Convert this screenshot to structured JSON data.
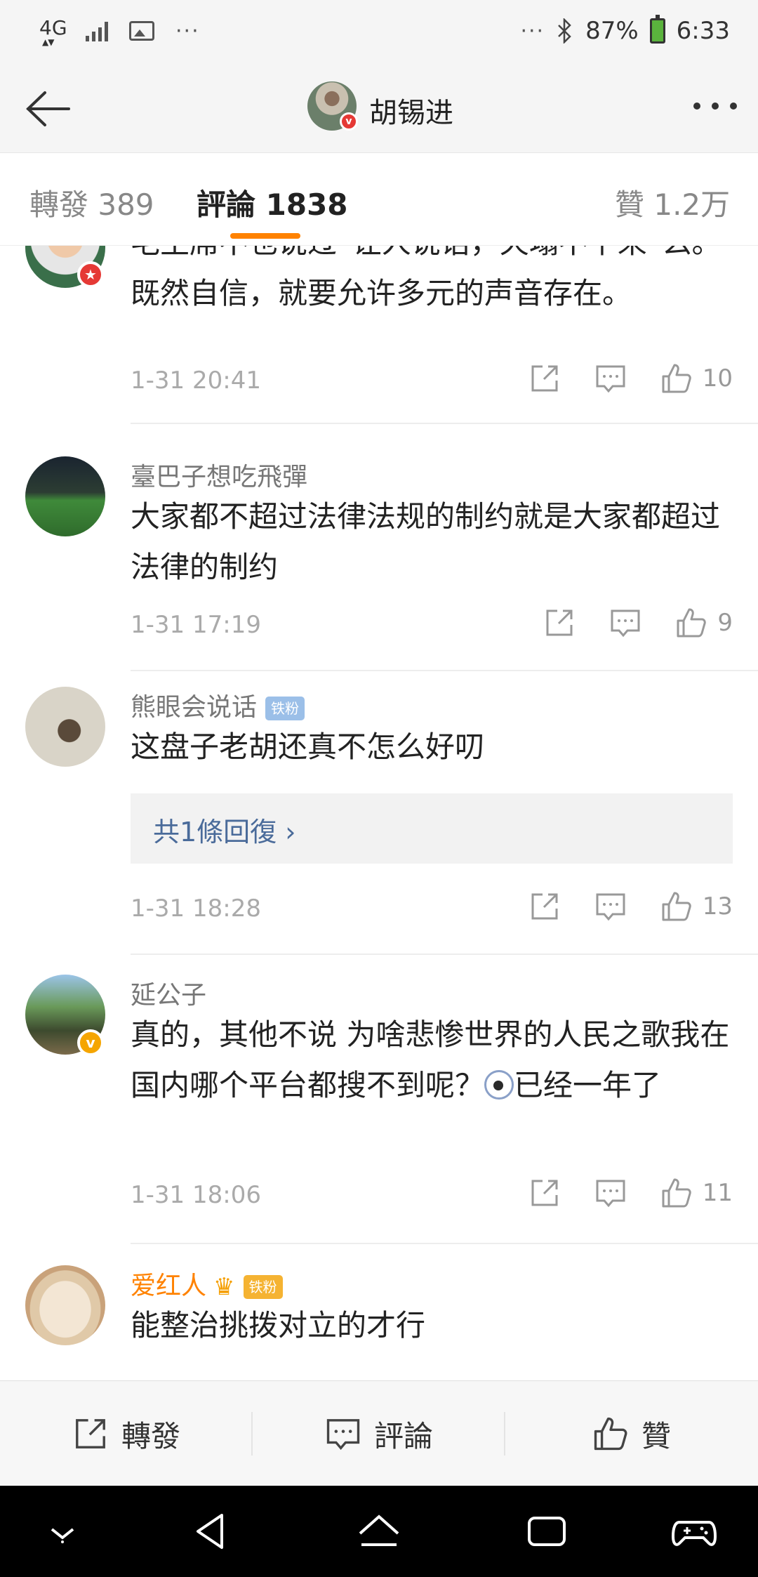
{
  "status_bar": {
    "network": "4G",
    "more": "···",
    "right_more": "···",
    "battery": "87%",
    "time": "6:33"
  },
  "header": {
    "back_icon": "back-arrow-icon",
    "title": "胡锡进",
    "more_icon": "more-dots-icon"
  },
  "tabs": [
    {
      "label": "轉發 389"
    },
    {
      "label": "評論 1838"
    },
    {
      "label": "贊 1.2万"
    }
  ],
  "colors": {
    "accent": "#ff8200",
    "link": "#4a6b9a"
  },
  "comments": [
    {
      "name": "",
      "text": "毛主席不也说过“让人说话，天塌不下来”么。既然自信，就要允许多元的声音存在。",
      "time": "1-31 20:41",
      "likes": "10"
    },
    {
      "name": "臺巴子想吃飛彈",
      "text": "大家都不超过法律法规的制约就是大家都超过法律的制约",
      "time": "1-31 17:19",
      "likes": "9"
    },
    {
      "name": "熊眼会说话",
      "badge": "铁粉",
      "text": "这盘子老胡还真不怎么好叨",
      "reply": "共1條回復 ›",
      "time": "1-31 18:28",
      "likes": "13"
    },
    {
      "name": "延公子",
      "text_a": "真的，其他不说 为啥悲惨世界的人民之歌我在国内哪个平台都搜不到呢？",
      "text_b": "已经一年了",
      "time": "1-31 18:06",
      "likes": "11"
    },
    {
      "name": "爱红人",
      "badge": "铁粉",
      "text": "能整治挑拨对立的才行"
    }
  ],
  "toolbar": {
    "repost": "轉發",
    "comment": "評論",
    "like": "贊"
  }
}
